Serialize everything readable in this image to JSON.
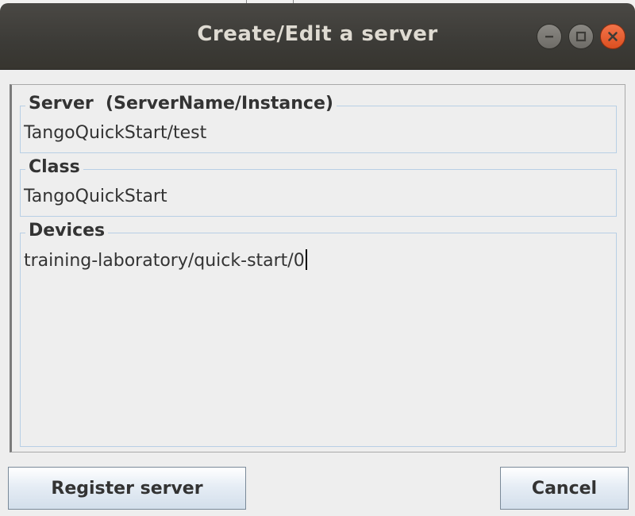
{
  "window": {
    "title": "Create/Edit a server"
  },
  "form": {
    "server": {
      "label": "Server  (ServerName/Instance)",
      "value": "TangoQuickStart/test"
    },
    "class": {
      "label": "Class",
      "value": "TangoQuickStart"
    },
    "devices": {
      "label": "Devices",
      "value": "training-laboratory/quick-start/0"
    }
  },
  "buttons": {
    "register_label": "Register server",
    "cancel_label": "Cancel"
  },
  "colors": {
    "titlebar": "#3c3b37",
    "close_button": "#e95420",
    "group_border": "#b8cfe5",
    "button_border": "#7a8a99"
  },
  "icons": [
    "minimize-icon",
    "maximize-icon",
    "close-icon"
  ]
}
